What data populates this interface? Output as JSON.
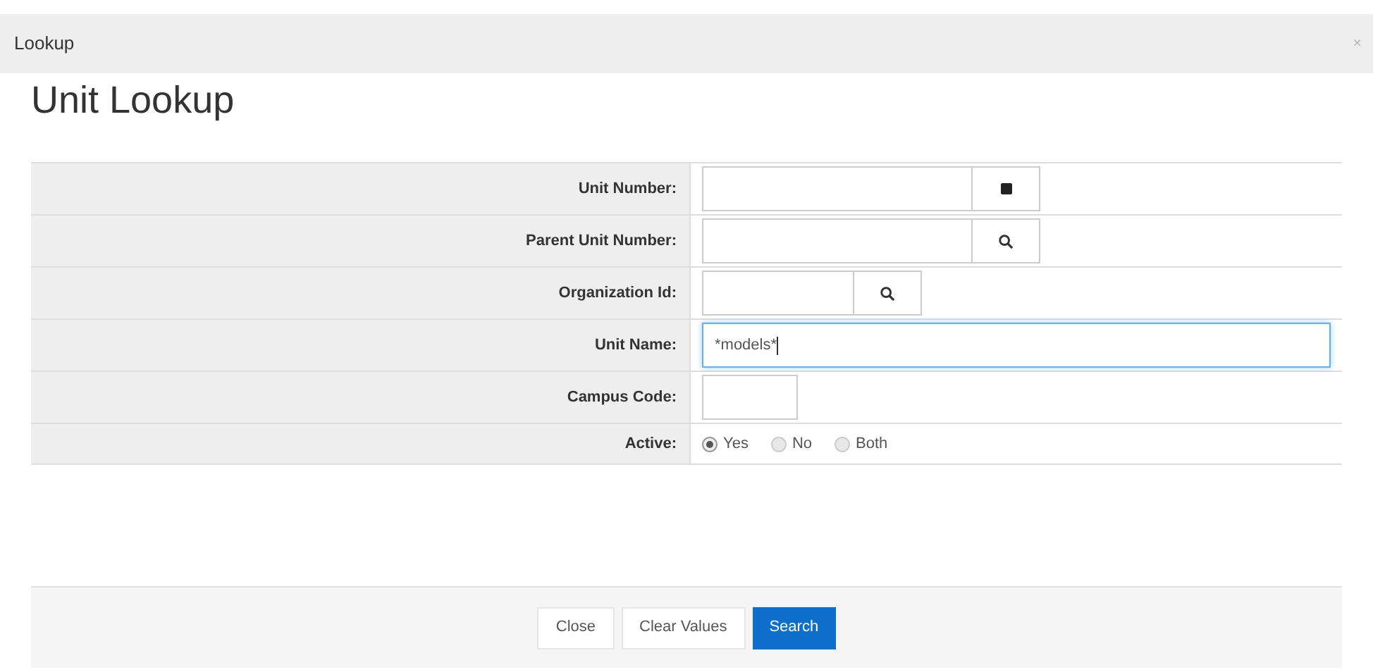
{
  "window": {
    "title": "Lookup",
    "close": "×"
  },
  "heading": "Unit Lookup",
  "fields": [
    {
      "label": "Unit Number:",
      "kind": "inquiry",
      "focused": false
    },
    {
      "label": "Parent Unit Number:",
      "kind": "lookup",
      "focused": false
    },
    {
      "label": "Organization Id:",
      "kind": "lookup",
      "focused": false
    },
    {
      "label": "Unit Name:",
      "kind": "text",
      "value": "*models*",
      "focused": true
    },
    {
      "label": "Campus Code:",
      "kind": "text",
      "focused": false
    },
    {
      "label": "Active:",
      "kind": "radio",
      "options": [
        {
          "label": "Yes",
          "selected": true
        },
        {
          "label": "No",
          "selected": false
        },
        {
          "label": "Both",
          "selected": false
        }
      ]
    }
  ],
  "buttons": [
    {
      "label": "Close",
      "kind": "default"
    },
    {
      "label": "Clear Values",
      "kind": "default"
    },
    {
      "label": "Search",
      "kind": "primary"
    }
  ]
}
